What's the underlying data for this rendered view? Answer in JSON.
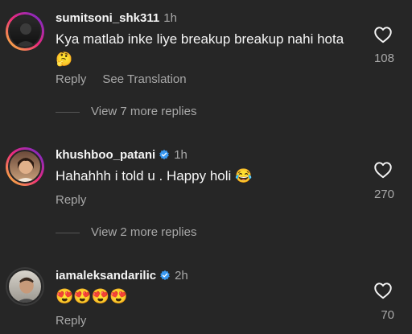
{
  "comments": [
    {
      "username": "sumitsoni_shk311",
      "time": "1h",
      "text": "Kya matlab inke liye breakup breakup nahi hota 🤔",
      "reply": "Reply",
      "translate": "See Translation",
      "likes": "108",
      "more_replies": "View 7 more replies",
      "verified": false
    },
    {
      "username": "khushboo_patani",
      "time": "1h",
      "text": "Hahahhh i told u . Happy holi 😂",
      "reply": "Reply",
      "likes": "270",
      "more_replies": "View 2 more replies",
      "verified": true
    },
    {
      "username": "iamaleksandarilic",
      "time": "2h",
      "text": "😍😍😍😍",
      "reply": "Reply",
      "likes": "70",
      "verified": true
    }
  ],
  "icons": {
    "like": "heart-outline-icon",
    "verified": "verified-badge-icon"
  },
  "colors": {
    "background": "#262626",
    "text": "#f5f5f5",
    "secondary": "#a8a8a8",
    "verified": "#3897f0"
  }
}
